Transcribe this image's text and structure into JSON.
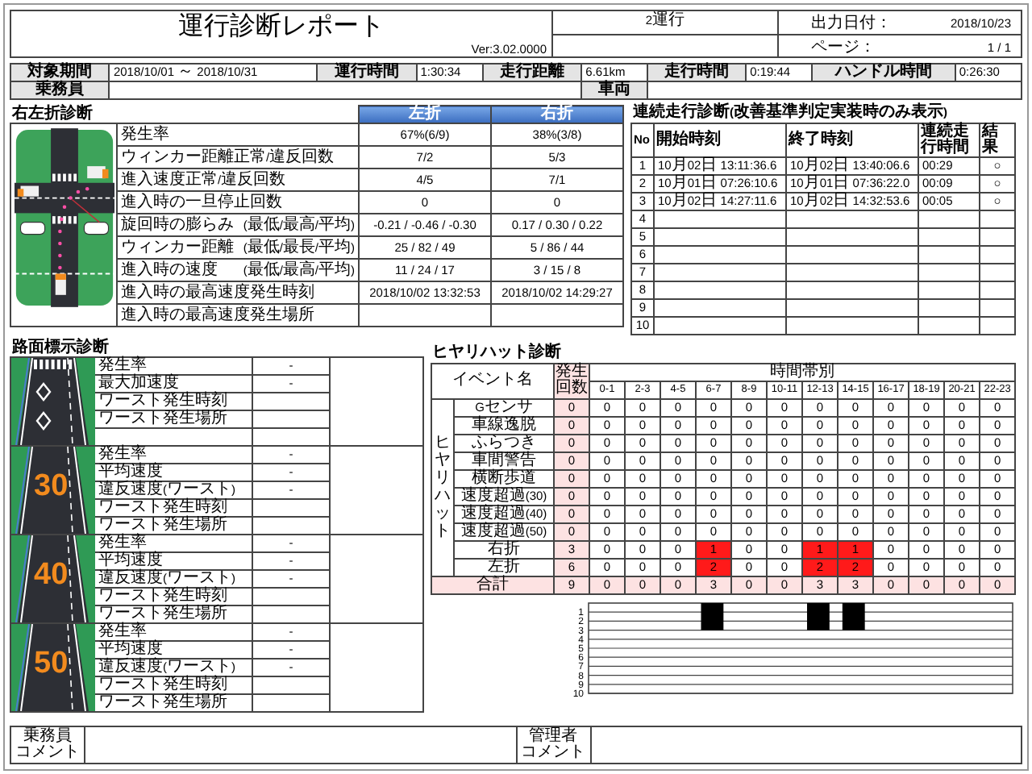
{
  "header": {
    "title": "運行診断レポート",
    "version": "Ver:3.02.0000",
    "trip": "2運行",
    "meta": [
      {
        "label": "出力日付：",
        "value": "2018/10/23"
      },
      {
        "label": "ページ：",
        "value": "1 / 1"
      }
    ]
  },
  "summary": {
    "rows": [
      [
        {
          "label": "対象期間",
          "value": "2018/10/01 ～ 2018/10/31"
        },
        {
          "label": "運行時間",
          "value": "1:30:34"
        },
        {
          "label": "走行距離",
          "value": "6.61km"
        },
        {
          "label": "走行時間",
          "value": "0:19:44"
        },
        {
          "label": "ハンドル時間",
          "value": "0:26:30"
        }
      ],
      [
        {
          "label": "乗務員"
        },
        {
          "label": "車両"
        }
      ]
    ]
  },
  "turn_diagnosis": {
    "title": "右左折診断",
    "columns": [
      "左折",
      "右折"
    ],
    "rows": [
      {
        "label": "発生率",
        "values": [
          "67%(6/9)",
          "38%(3/8)"
        ]
      },
      {
        "label": "ウィンカー距離正常/違反回数",
        "values": [
          "7/2",
          "5/3"
        ]
      },
      {
        "label": "進入速度正常/違反回数",
        "values": [
          "4/5",
          "7/1"
        ]
      },
      {
        "label": "進入時の一旦停止回数",
        "values": [
          "0",
          "0"
        ]
      },
      {
        "label": "旋回時の膨らみ",
        "sub": "(最低/最高/平均)",
        "values": [
          "-0.21 / -0.46 / -0.30",
          "0.17 / 0.30 / 0.22"
        ]
      },
      {
        "label": "ウィンカー距離",
        "sub": "(最低/最長/平均)",
        "values": [
          "25 / 82 / 49",
          "5 / 86 / 44"
        ]
      },
      {
        "label": "進入時の速度",
        "sub": "(最低/最高/平均)",
        "values": [
          "11 / 24 / 17",
          "3 / 15 / 8"
        ]
      },
      {
        "label": "進入時の最高速度発生時刻",
        "values": [
          "2018/10/02 13:32:53",
          "2018/10/02 14:29:27"
        ]
      },
      {
        "label": "進入時の最高速度発生場所"
      }
    ]
  },
  "continuous_driving": {
    "title": "連続走行診断(改善基準判定実装時のみ表示)",
    "columns": [
      "No",
      "開始時刻",
      "終了時刻",
      "連続走行時間",
      "結果"
    ],
    "rows": [
      {
        "no": "1",
        "start": "10月02日 13:11:36.6",
        "end": "10月02日 13:40:06.6",
        "duration": "00:29",
        "result": "○"
      },
      {
        "no": "2",
        "start": "10月01日 07:26:10.6",
        "end": "10月01日 07:36:22.0",
        "duration": "00:09",
        "result": "○"
      },
      {
        "no": "3",
        "start": "10月02日 14:27:11.6",
        "end": "10月02日 14:32:53.6",
        "duration": "00:05",
        "result": "○"
      },
      {
        "no": "4"
      },
      {
        "no": "5"
      },
      {
        "no": "6"
      },
      {
        "no": "7"
      },
      {
        "no": "8"
      },
      {
        "no": "9"
      },
      {
        "no": "10"
      }
    ]
  },
  "road_markings": {
    "title": "路面標示診断",
    "blocks": [
      {
        "kind": "crosswalk",
        "rows": [
          {
            "label": "発生率",
            "value": "-"
          },
          {
            "label": "最大加速度",
            "value": "-"
          },
          {
            "label": "ワースト発生時刻"
          },
          {
            "label": "ワースト発生場所"
          }
        ]
      },
      {
        "kind": "speed_limit",
        "sign": "30",
        "rows": [
          {
            "label": "発生率",
            "value": "-"
          },
          {
            "label": "平均速度",
            "value": "-"
          },
          {
            "label": "違反速度(ワースト)",
            "value": "-"
          },
          {
            "label": "ワースト発生時刻"
          },
          {
            "label": "ワースト発生場所"
          }
        ]
      },
      {
        "kind": "speed_limit",
        "sign": "40",
        "rows": [
          {
            "label": "発生率",
            "value": "-"
          },
          {
            "label": "平均速度",
            "value": "-"
          },
          {
            "label": "違反速度(ワースト)",
            "value": "-"
          },
          {
            "label": "ワースト発生時刻"
          },
          {
            "label": "ワースト発生場所"
          }
        ]
      },
      {
        "kind": "speed_limit",
        "sign": "50",
        "rows": [
          {
            "label": "発生率",
            "value": "-"
          },
          {
            "label": "平均速度",
            "value": "-"
          },
          {
            "label": "違反速度(ワースト)",
            "value": "-"
          },
          {
            "label": "ワースト発生時刻"
          },
          {
            "label": "ワースト発生場所"
          }
        ]
      }
    ]
  },
  "near_miss": {
    "title": "ヒヤリハット診断",
    "side_label": "ヒヤリハット",
    "event_header": "イベント名",
    "total_header": "発生回数",
    "hours_header": "時間帯別",
    "hours": [
      "0-1",
      "2-3",
      "4-5",
      "6-7",
      "8-9",
      "10-11",
      "12-13",
      "14-15",
      "16-17",
      "18-19",
      "20-21",
      "22-23"
    ],
    "rows": [
      {
        "kind": "event",
        "event": "Gセンサ",
        "total": "0",
        "counts": [
          "0",
          "0",
          "0",
          "0",
          "0",
          "0",
          "0",
          "0",
          "0",
          "0",
          "0",
          "0"
        ]
      },
      {
        "kind": "event",
        "event": "車線逸脱",
        "total": "0",
        "counts": [
          "0",
          "0",
          "0",
          "0",
          "0",
          "0",
          "0",
          "0",
          "0",
          "0",
          "0",
          "0"
        ]
      },
      {
        "kind": "event",
        "event": "ふらつき",
        "total": "0",
        "counts": [
          "0",
          "0",
          "0",
          "0",
          "0",
          "0",
          "0",
          "0",
          "0",
          "0",
          "0",
          "0"
        ]
      },
      {
        "kind": "event",
        "event": "車間警告",
        "total": "0",
        "counts": [
          "0",
          "0",
          "0",
          "0",
          "0",
          "0",
          "0",
          "0",
          "0",
          "0",
          "0",
          "0"
        ]
      },
      {
        "kind": "event",
        "event": "横断歩道",
        "total": "0",
        "counts": [
          "0",
          "0",
          "0",
          "0",
          "0",
          "0",
          "0",
          "0",
          "0",
          "0",
          "0",
          "0"
        ]
      },
      {
        "kind": "event",
        "event": "速度超過(30)",
        "total": "0",
        "counts": [
          "0",
          "0",
          "0",
          "0",
          "0",
          "0",
          "0",
          "0",
          "0",
          "0",
          "0",
          "0"
        ]
      },
      {
        "kind": "event",
        "event": "速度超過(40)",
        "total": "0",
        "counts": [
          "0",
          "0",
          "0",
          "0",
          "0",
          "0",
          "0",
          "0",
          "0",
          "0",
          "0",
          "0"
        ]
      },
      {
        "kind": "event",
        "event": "速度超過(50)",
        "total": "0",
        "counts": [
          "0",
          "0",
          "0",
          "0",
          "0",
          "0",
          "0",
          "0",
          "0",
          "0",
          "0",
          "0"
        ]
      },
      {
        "kind": "event",
        "event": "右折",
        "total": "3",
        "counts": [
          "0",
          "0",
          "0",
          "1",
          "0",
          "0",
          "1",
          "1",
          "0",
          "0",
          "0",
          "0"
        ],
        "highlight": [
          false,
          false,
          false,
          true,
          false,
          false,
          true,
          true,
          false,
          false,
          false,
          false
        ]
      },
      {
        "kind": "event",
        "event": "左折",
        "total": "6",
        "counts": [
          "0",
          "0",
          "0",
          "2",
          "0",
          "0",
          "2",
          "2",
          "0",
          "0",
          "0",
          "0"
        ],
        "highlight": [
          false,
          false,
          false,
          true,
          false,
          false,
          true,
          true,
          false,
          false,
          false,
          false
        ]
      },
      {
        "kind": "total",
        "event": "合計",
        "total": "9",
        "counts": [
          "0",
          "0",
          "0",
          "3",
          "0",
          "0",
          "3",
          "3",
          "0",
          "0",
          "0",
          "0"
        ]
      }
    ],
    "chart_data": {
      "type": "bar",
      "series": [
        {
          "color": "#000000",
          "values": [
            0,
            0,
            0,
            3,
            0,
            0,
            3,
            3,
            0,
            0,
            0,
            0
          ]
        }
      ],
      "ylim": [
        10,
        0
      ],
      "grid": true,
      "yticks": [
        1,
        2,
        3,
        4,
        5,
        6,
        7,
        8,
        9,
        10
      ]
    }
  },
  "comments": [
    {
      "label": [
        "乗務員",
        "コメント"
      ]
    },
    {
      "label": [
        "管理者",
        "コメント"
      ]
    }
  ]
}
